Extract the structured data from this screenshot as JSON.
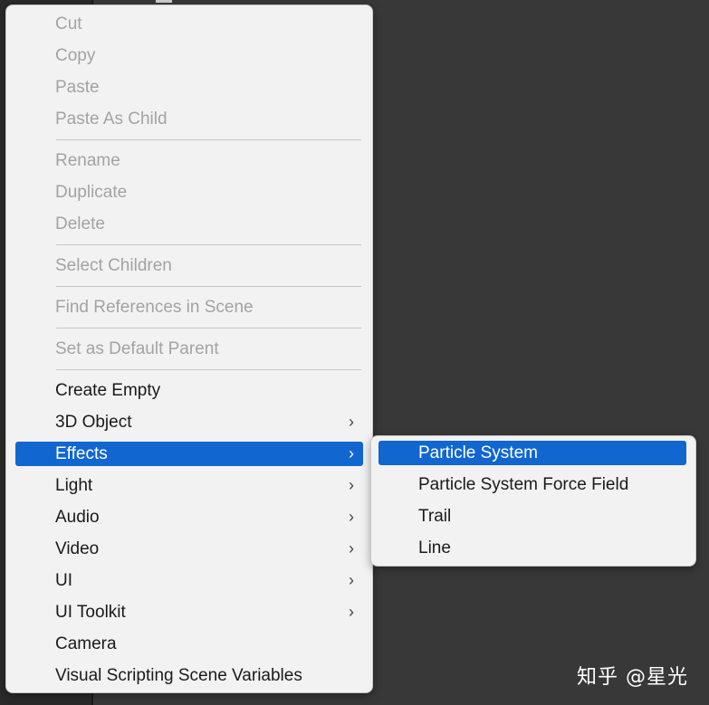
{
  "context_menu": {
    "items": [
      {
        "label": "Cut",
        "enabled": false,
        "submenu": false
      },
      {
        "label": "Copy",
        "enabled": false,
        "submenu": false
      },
      {
        "label": "Paste",
        "enabled": false,
        "submenu": false
      },
      {
        "label": "Paste As Child",
        "enabled": false,
        "submenu": false
      },
      {
        "label": "Rename",
        "enabled": false,
        "submenu": false
      },
      {
        "label": "Duplicate",
        "enabled": false,
        "submenu": false
      },
      {
        "label": "Delete",
        "enabled": false,
        "submenu": false
      },
      {
        "label": "Select Children",
        "enabled": false,
        "submenu": false
      },
      {
        "label": "Find References in Scene",
        "enabled": false,
        "submenu": false
      },
      {
        "label": "Set as Default Parent",
        "enabled": false,
        "submenu": false
      },
      {
        "label": "Create Empty",
        "enabled": true,
        "submenu": false
      },
      {
        "label": "3D Object",
        "enabled": true,
        "submenu": true
      },
      {
        "label": "Effects",
        "enabled": true,
        "submenu": true,
        "highlighted": true
      },
      {
        "label": "Light",
        "enabled": true,
        "submenu": true
      },
      {
        "label": "Audio",
        "enabled": true,
        "submenu": true
      },
      {
        "label": "Video",
        "enabled": true,
        "submenu": true
      },
      {
        "label": "UI",
        "enabled": true,
        "submenu": true
      },
      {
        "label": "UI Toolkit",
        "enabled": true,
        "submenu": true
      },
      {
        "label": "Camera",
        "enabled": true,
        "submenu": false
      },
      {
        "label": "Visual Scripting Scene Variables",
        "enabled": true,
        "submenu": false
      }
    ],
    "submenu_icon": "chevron-right-icon"
  },
  "effects_submenu": {
    "items": [
      {
        "label": "Particle System",
        "highlighted": true
      },
      {
        "label": "Particle System Force Field"
      },
      {
        "label": "Trail"
      },
      {
        "label": "Line"
      }
    ]
  },
  "watermark": {
    "text": "知乎 @星光"
  },
  "colors": {
    "background": "#383838",
    "menu_background": "#f2f2f2",
    "highlight": "#1166d0",
    "disabled_text": "#a3a3a3",
    "text": "#1a1a1a"
  }
}
